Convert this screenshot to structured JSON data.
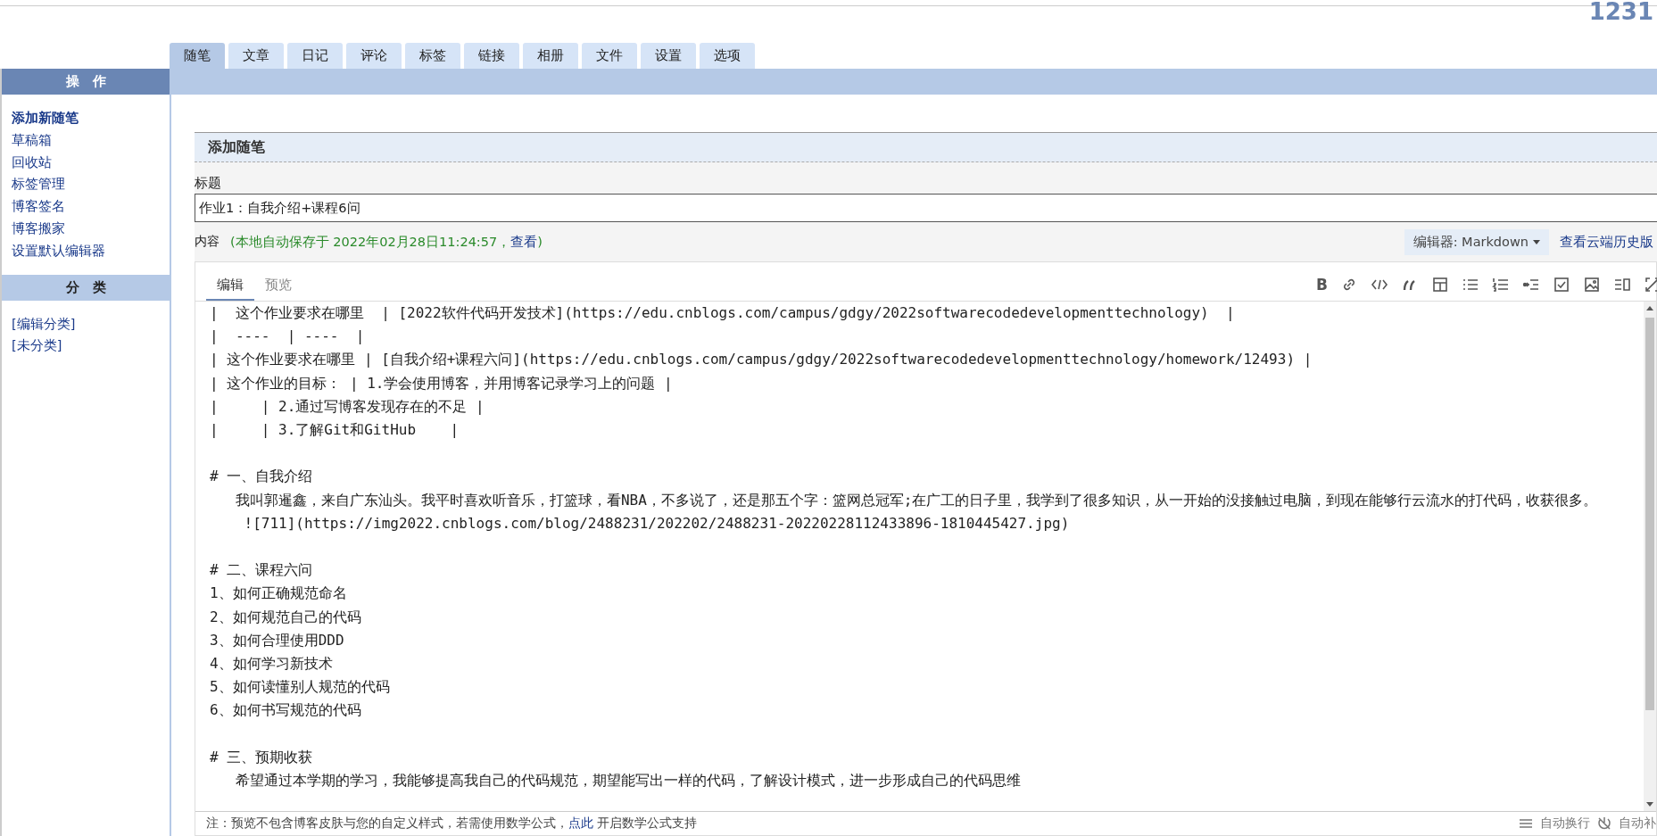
{
  "site_title": "1231",
  "tabs": [
    {
      "label": "随笔",
      "selected": true
    },
    {
      "label": "文章",
      "selected": false
    },
    {
      "label": "日记",
      "selected": false
    },
    {
      "label": "评论",
      "selected": false
    },
    {
      "label": "标签",
      "selected": false
    },
    {
      "label": "链接",
      "selected": false
    },
    {
      "label": "相册",
      "selected": false
    },
    {
      "label": "文件",
      "selected": false
    },
    {
      "label": "设置",
      "selected": false
    },
    {
      "label": "选项",
      "selected": false
    }
  ],
  "sidebar": {
    "sections": [
      {
        "title": "操　作",
        "kind": "dark",
        "items": [
          {
            "label": "添加新随笔",
            "selected": true
          },
          {
            "label": "草稿箱",
            "selected": false
          },
          {
            "label": "回收站",
            "selected": false
          },
          {
            "label": "标签管理",
            "selected": false
          },
          {
            "label": "博客签名",
            "selected": false
          },
          {
            "label": "博客搬家",
            "selected": false
          },
          {
            "label": "设置默认编辑器",
            "selected": false
          }
        ]
      },
      {
        "title": "分　类",
        "kind": "light",
        "items": [
          {
            "label": "[编辑分类]",
            "selected": false
          },
          {
            "label": "[未分类]",
            "selected": false
          }
        ]
      }
    ]
  },
  "form": {
    "heading": "添加随笔",
    "title_label": "标题",
    "title_value": "作业1：自我介绍+课程6问",
    "content_label": "内容",
    "autosave": {
      "text": "(本地自动保存于 2022年02月28日11:24:57，",
      "link": "查看",
      "after": ")"
    },
    "editor_select": "编辑器: Markdown",
    "history_link": "查看云端历史版"
  },
  "editor": {
    "tabs": [
      {
        "label": "编辑",
        "selected": true
      },
      {
        "label": "预览",
        "selected": false
      }
    ],
    "bold_label": "B",
    "lines": [
      {
        "kind": "text",
        "text": "|  这个作业要求在哪里  | [2022软件代码开发技术](https://edu.cnblogs.com/campus/gdgy/2022softwarecodedevelopmenttechnology)  |"
      },
      {
        "kind": "text",
        "text": "|  ----  | ----  |"
      },
      {
        "kind": "text",
        "text": "| 这个作业要求在哪里 | [自我介绍+课程六问](https://edu.cnblogs.com/campus/gdgy/2022softwarecodedevelopmenttechnology/homework/12493) |"
      },
      {
        "kind": "text",
        "text": "| 这个作业的目标： | 1.学会使用博客，并用博客记录学习上的问题 |"
      },
      {
        "kind": "text",
        "text": "|     | 2.通过写博客发现存在的不足 |"
      },
      {
        "kind": "text",
        "text": "|     | 3.了解Git和GitHub    |"
      },
      {
        "kind": "blank"
      },
      {
        "kind": "text",
        "text": "# 一、自我介绍"
      },
      {
        "kind": "text",
        "text": "   我叫郭暹鑫，来自广东汕头。我平时喜欢听音乐，打篮球，看NBA，不多说了，还是那五个字：篮网总冠军;在广工的日子里，我学到了很多知识，从一开始的没接触过电脑，到现在能够行云流水的打代码，收获很多。"
      },
      {
        "kind": "text",
        "text": "    ![711](https://img2022.cnblogs.com/blog/2488231/202202/2488231-20220228112433896-1810445427.jpg)"
      },
      {
        "kind": "blank"
      },
      {
        "kind": "text",
        "text": "# 二、课程六问"
      },
      {
        "kind": "text",
        "text": "1、如何正确规范命名"
      },
      {
        "kind": "text",
        "text": "2、如何规范自己的代码"
      },
      {
        "kind": "text",
        "text": "3、如何合理使用DDD"
      },
      {
        "kind": "text",
        "text": "4、如何学习新技术"
      },
      {
        "kind": "text",
        "text": "5、如何读懂别人规范的代码"
      },
      {
        "kind": "text",
        "text": "6、如何书写规范的代码"
      },
      {
        "kind": "blank"
      },
      {
        "kind": "text",
        "text": "# 三、预期收获"
      },
      {
        "kind": "text",
        "text": "   希望通过本学期的学习，我能够提高我自己的代码规范，期望能写出一样的代码，了解设计模式，进一步形成自己的代码思维"
      }
    ]
  },
  "footer": {
    "note": "注：预览不包含博客皮肤与您的自定义样式，若需使用数学公式，",
    "note_link": "点此",
    "note_after": " 开启数学公式支持",
    "wrap_label": "自动换行",
    "complete_label": "自动补"
  }
}
